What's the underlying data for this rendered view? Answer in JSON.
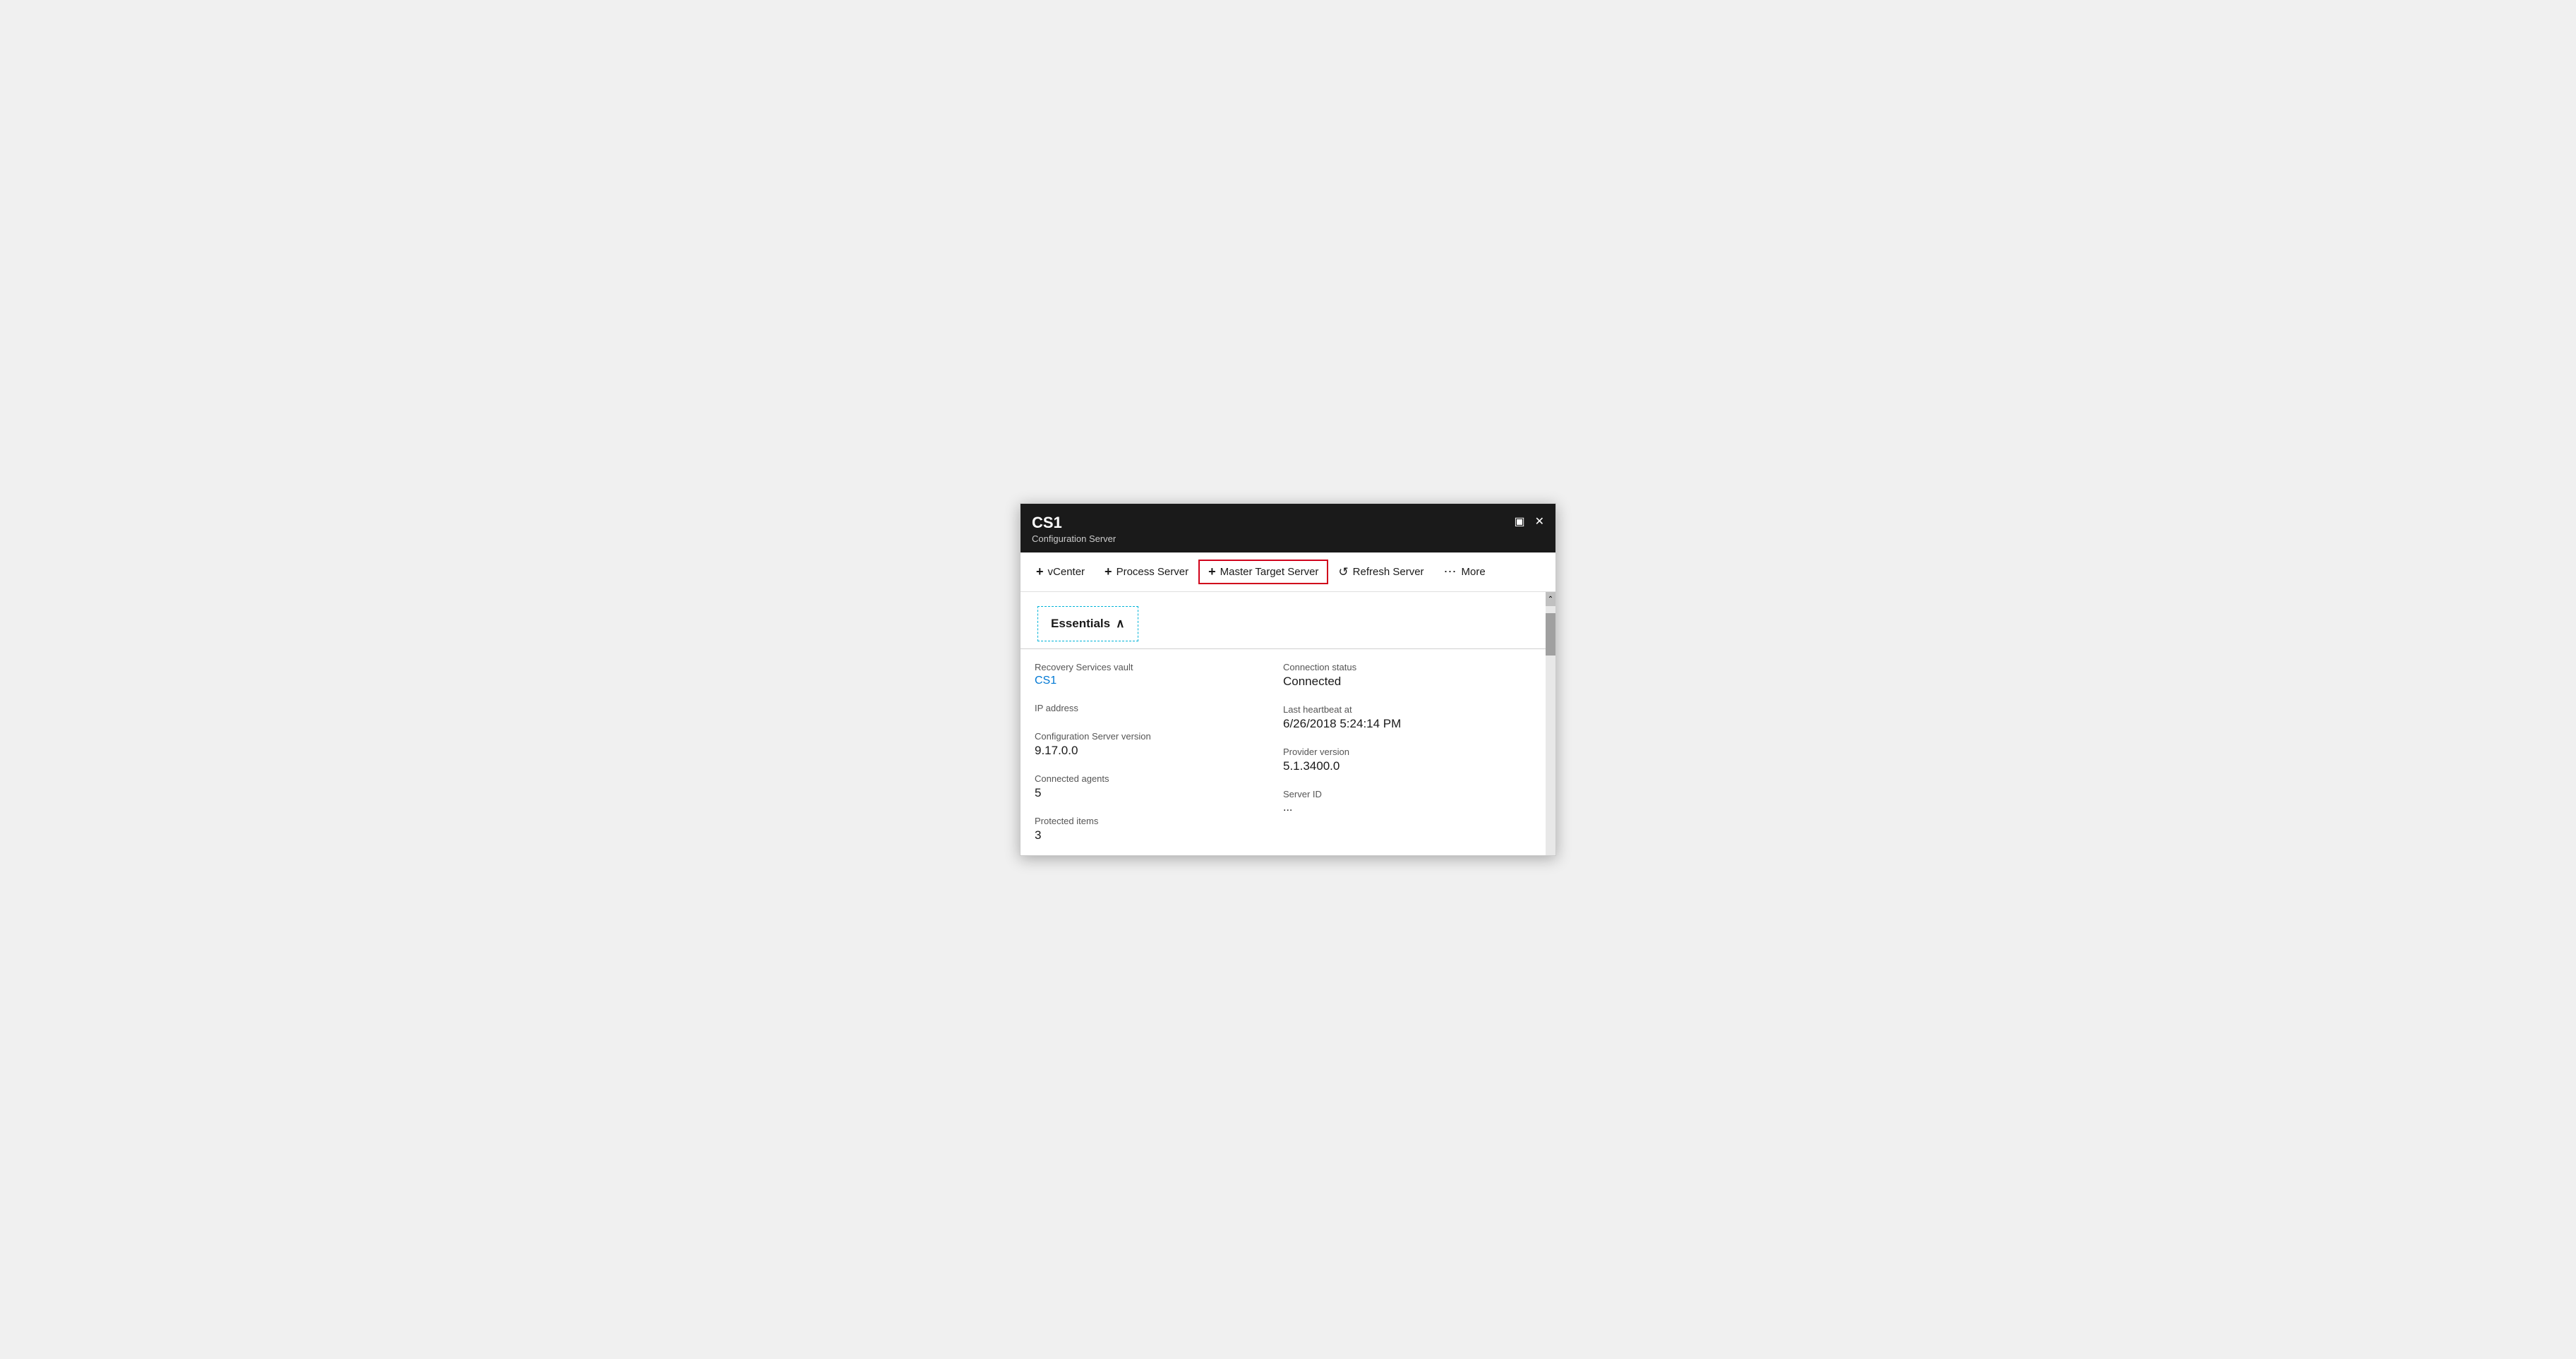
{
  "titlebar": {
    "title": "CS1",
    "subtitle": "Configuration Server",
    "controls": {
      "minimize": "🗖",
      "close": "✕"
    }
  },
  "toolbar": {
    "vcenter_label": "vCenter",
    "process_server_label": "Process Server",
    "master_target_label": "Master Target Server",
    "refresh_label": "Refresh Server",
    "more_label": "More"
  },
  "essentials": {
    "header": "Essentials",
    "chevron": "∧",
    "fields": {
      "left": [
        {
          "label": "Recovery Services vault",
          "value": "CS1",
          "is_link": true
        },
        {
          "label": "IP address",
          "value": "",
          "is_link": false
        },
        {
          "label": "Configuration Server version",
          "value": "9.17.0.0",
          "is_link": false
        },
        {
          "label": "Connected agents",
          "value": "5",
          "is_link": false
        },
        {
          "label": "Protected items",
          "value": "3",
          "is_link": false
        }
      ],
      "right": [
        {
          "label": "Connection status",
          "value": "Connected",
          "is_link": false
        },
        {
          "label": "Last heartbeat at",
          "value": "6/26/2018 5:24:14 PM",
          "is_link": false
        },
        {
          "label": "Provider version",
          "value": "5.1.3400.0",
          "is_link": false
        },
        {
          "label": "Server ID",
          "value": "...",
          "is_link": false
        }
      ]
    }
  }
}
